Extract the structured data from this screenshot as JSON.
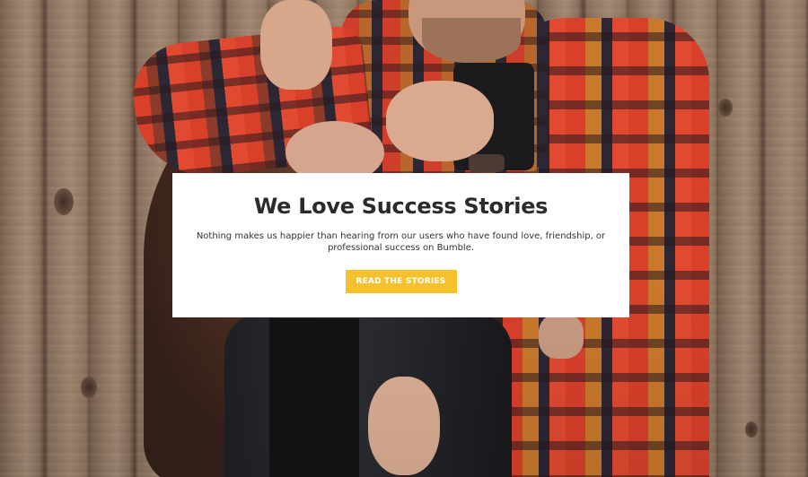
{
  "hero": {
    "image_alt": "couple-photo"
  },
  "card": {
    "title": "We Love Success Stories",
    "body": "Nothing makes us happier than hearing from our users who have found love, friendship, or professional success on Bumble.",
    "button_label": "READ THE STORIES"
  },
  "colors": {
    "button_bg": "#f5c22d",
    "title_text": "#2b2b2b",
    "card_bg": "#ffffff"
  }
}
